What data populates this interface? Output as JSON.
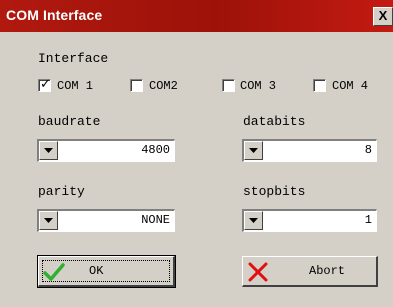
{
  "window": {
    "title": "COM Interface",
    "close_glyph": "X"
  },
  "interface": {
    "label": "Interface",
    "ports": [
      {
        "label": "COM 1",
        "checked": true
      },
      {
        "label": "COM2",
        "checked": false
      },
      {
        "label": "COM 3",
        "checked": false
      },
      {
        "label": "COM 4",
        "checked": false
      }
    ],
    "check_glyph": "✓"
  },
  "baudrate": {
    "label": "baudrate",
    "value": "4800"
  },
  "databits": {
    "label": "databits",
    "value": "8"
  },
  "parity": {
    "label": "parity",
    "value": "NONE"
  },
  "stopbits": {
    "label": "stopbits",
    "value": "1"
  },
  "buttons": {
    "ok": {
      "label": "OK",
      "icon": "checkmark-icon"
    },
    "abort": {
      "label": "Abort",
      "icon": "cross-icon"
    }
  },
  "colors": {
    "titlebar": "#a8160c",
    "ok_icon": "#2fb02f",
    "abort_icon": "#e01010",
    "window_bg": "#d4d0c8"
  }
}
